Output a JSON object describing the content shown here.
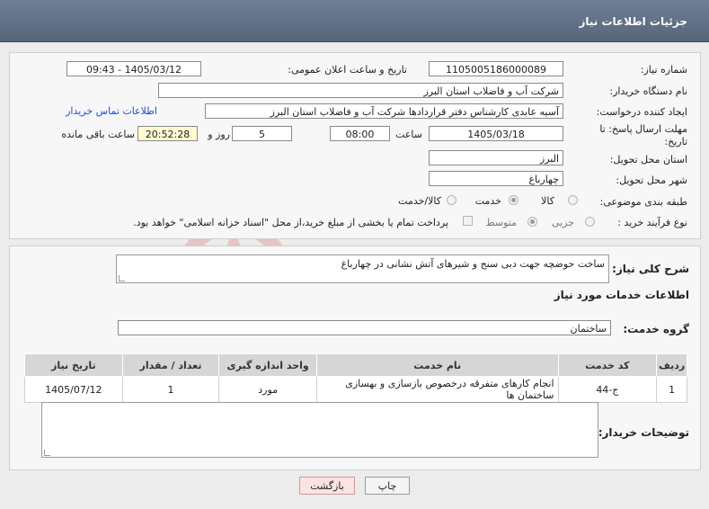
{
  "header": {
    "title": "جزئیات اطلاعات نیاز"
  },
  "fields": {
    "need_number_label": "شماره نیاز:",
    "need_number": "1105005186000089",
    "announce_label": "تاریخ و ساعت اعلان عمومی:",
    "announce_value": "1405/03/12 - 09:43",
    "buyer_org_label": "نام دستگاه خریدار:",
    "buyer_org": "شرکت آب و فاضلاب استان البرز",
    "creator_label": "ایجاد کننده درخواست:",
    "creator": "آسیه عابدی کارشناس دفتر قراردادها شرکت آب و فاضلاب استان البرز",
    "contact_link": "اطلاعات تماس خریدار",
    "deadline_label": "مهلت ارسال پاسخ: تا تاریخ:",
    "deadline_date": "1405/03/18",
    "time_label": "ساعت",
    "deadline_time": "08:00",
    "days_value": "5",
    "days_label": "روز و",
    "remaining_time": "20:52:28",
    "remaining_label": "ساعت باقی مانده",
    "province_label": "استان محل تحویل:",
    "province": "البرز",
    "city_label": "شهر محل تحویل:",
    "city": "چهارباغ",
    "category_label": "طبقه بندی موضوعی:",
    "category_options": [
      "کالا",
      "خدمت",
      "کالا/خدمت"
    ],
    "category_selected": "خدمت",
    "process_label": "نوع فرآیند خرید :",
    "process_options": [
      "جزیی",
      "متوسط"
    ],
    "process_selected": "متوسط",
    "payment_note": "پرداخت تمام یا بخشی از مبلغ خرید،از محل \"اسناد خزانه اسلامی\" خواهد بود."
  },
  "description": {
    "label": "شرح کلی نیاز:",
    "value": "ساخت حوضچه جهت دبی سنج و شیرهای آتش نشانی در چهارباغ"
  },
  "services": {
    "section_title": "اطلاعات خدمات مورد نیاز",
    "group_label": "گروه خدمت:",
    "group_value": "ساختمان",
    "columns": [
      "ردیف",
      "کد خدمت",
      "نام خدمت",
      "واحد اندازه گیری",
      "تعداد / مقدار",
      "تاریخ نیاز"
    ],
    "rows": [
      [
        "1",
        "ج-44",
        "انجام کارهای متفرقه درخصوص بازسازی و بهسازی ساختمان ها",
        "مورد",
        "1",
        "1405/07/12"
      ]
    ]
  },
  "buyer_notes": {
    "label": "توضیحات خریدار:",
    "value": ""
  },
  "buttons": {
    "print": "چاپ",
    "back": "بازگشت"
  },
  "colors": {
    "header": "#5f6f84",
    "link": "#1a4fd6",
    "back_button": "#fbe3e3",
    "highlight": "#fffbd3"
  }
}
